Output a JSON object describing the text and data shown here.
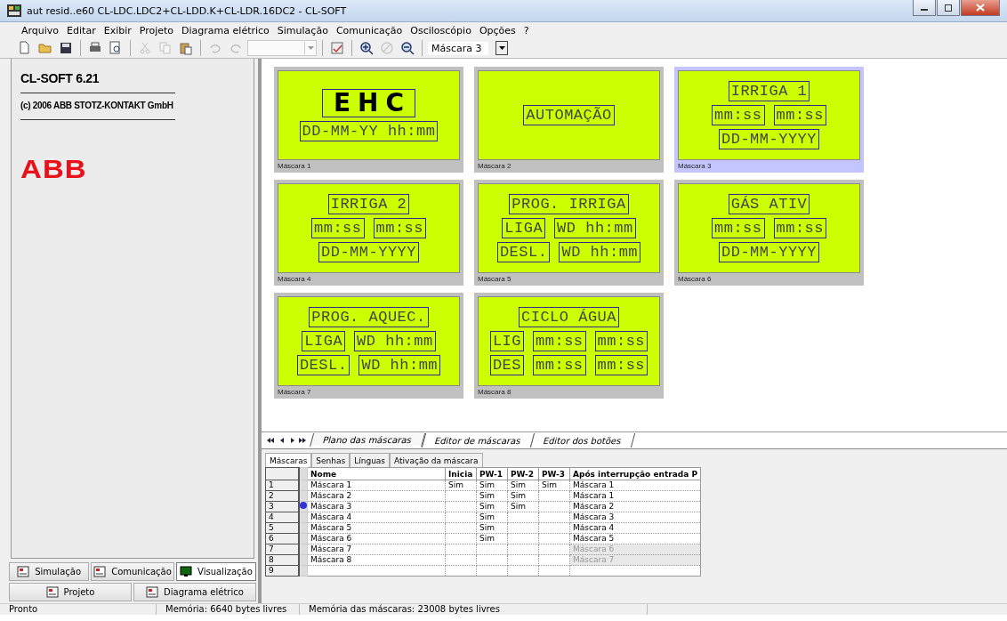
{
  "window": {
    "title": "aut resid..e60 CL-LDC.LDC2+CL-LDD.K+CL-LDR.16DC2 - CL-SOFT"
  },
  "menu": [
    "Arquivo",
    "Editar",
    "Exibir",
    "Projeto",
    "Diagrama elétrico",
    "Simulação",
    "Comunicação",
    "Osciloscópio",
    "Opções",
    "?"
  ],
  "toolbar": {
    "buttons": [
      {
        "disabled": false
      },
      {
        "disabled": false
      },
      {
        "disabled": false
      },
      {
        "disabled": false
      },
      {
        "disabled": false
      },
      {
        "disabled": true
      },
      {
        "disabled": true
      },
      {
        "disabled": false
      },
      {
        "disabled": true
      },
      {
        "disabled": true
      },
      {
        "disabled": false
      },
      {
        "disabled": false
      },
      {
        "disabled": true
      },
      {
        "disabled": false
      }
    ],
    "mask_select": {
      "value": "Máscara 3"
    }
  },
  "sidebar": {
    "title": "CL-SOFT 6.21",
    "copyright": "(c) 2006 ABB STOTZ-KONTAKT GmbH",
    "logo": "ABB",
    "nav": [
      {
        "label": "Simulação",
        "selected": false
      },
      {
        "label": "Comunicação",
        "selected": false
      },
      {
        "label": "Visualização",
        "selected": true
      },
      {
        "label": "Projeto",
        "selected": false
      },
      {
        "label": "Diagrama elétrico",
        "selected": false
      }
    ]
  },
  "masks": [
    {
      "label": "Máscara 1",
      "selected": false,
      "lines": [
        [
          {
            "text": "EHC",
            "kind": "bitmap"
          }
        ],
        [
          {
            "text": "DD-MM-YY hh:mm",
            "kind": "text"
          }
        ]
      ]
    },
    {
      "label": "Máscara 2",
      "selected": false,
      "lines": [
        [
          {
            "text": "AUTOMAÇÃO",
            "kind": "text"
          }
        ]
      ]
    },
    {
      "label": "Máscara 3",
      "selected": true,
      "lines": [
        [
          {
            "text": "IRRIGA 1",
            "kind": "text"
          }
        ],
        [
          {
            "text": "mm:ss",
            "kind": "text"
          },
          {
            "text": "mm:ss",
            "kind": "text"
          }
        ],
        [
          {
            "text": "DD-MM-YYYY",
            "kind": "text"
          }
        ]
      ]
    },
    {
      "label": "Máscara 4",
      "selected": false,
      "lines": [
        [
          {
            "text": "IRRIGA 2",
            "kind": "text"
          }
        ],
        [
          {
            "text": "mm:ss",
            "kind": "text"
          },
          {
            "text": "mm:ss",
            "kind": "text"
          }
        ],
        [
          {
            "text": "DD-MM-YYYY",
            "kind": "text"
          }
        ]
      ]
    },
    {
      "label": "Máscara 5",
      "selected": false,
      "lines": [
        [
          {
            "text": "PROG. IRRIGA",
            "kind": "text"
          }
        ],
        [
          {
            "text": "LIGA",
            "kind": "text"
          },
          {
            "text": "WD hh:mm",
            "kind": "text"
          }
        ],
        [
          {
            "text": "DESL.",
            "kind": "text"
          },
          {
            "text": "WD hh:mm",
            "kind": "text"
          }
        ]
      ]
    },
    {
      "label": "Máscara 6",
      "selected": false,
      "lines": [
        [
          {
            "text": "GÁS ATIV",
            "kind": "text"
          }
        ],
        [
          {
            "text": "mm:ss",
            "kind": "text"
          },
          {
            "text": "mm:ss",
            "kind": "text"
          }
        ],
        [
          {
            "text": "DD-MM-YYYY",
            "kind": "text"
          }
        ]
      ]
    },
    {
      "label": "Máscara 7",
      "selected": false,
      "lines": [
        [
          {
            "text": "PROG. AQUEC.",
            "kind": "text"
          }
        ],
        [
          {
            "text": "LIGA",
            "kind": "text"
          },
          {
            "text": "WD hh:mm",
            "kind": "text"
          }
        ],
        [
          {
            "text": "DESL.",
            "kind": "text"
          },
          {
            "text": "WD hh:mm",
            "kind": "text"
          }
        ]
      ]
    },
    {
      "label": "Máscara 8",
      "selected": false,
      "lines": [
        [
          {
            "text": "CICLO ÁGUA",
            "kind": "text"
          }
        ],
        [
          {
            "text": "LIG",
            "kind": "text"
          },
          {
            "text": "mm:ss",
            "kind": "text"
          },
          {
            "text": "mm:ss",
            "kind": "text"
          }
        ],
        [
          {
            "text": "DES",
            "kind": "text"
          },
          {
            "text": "mm:ss",
            "kind": "text"
          },
          {
            "text": "mm:ss",
            "kind": "text"
          }
        ]
      ]
    }
  ],
  "sheet_tabs": [
    {
      "label": "Plano das máscaras",
      "selected": true
    },
    {
      "label": "Editor de máscaras",
      "selected": false
    },
    {
      "label": "Editor dos botões",
      "selected": false
    }
  ],
  "table_tabs": [
    {
      "label": "Máscaras",
      "selected": true
    },
    {
      "label": "Senhas",
      "selected": false
    },
    {
      "label": "Línguas",
      "selected": false
    },
    {
      "label": "Ativação da máscara",
      "selected": false
    }
  ],
  "table": {
    "columns": [
      "Nome",
      "Inicia",
      "PW-1",
      "PW-2",
      "PW-3",
      "Após interrupção entrada P"
    ],
    "rows": [
      {
        "number": "1",
        "selected": false,
        "disabled": false,
        "cells": [
          "Máscara 1",
          "Sim",
          "Sim",
          "Sim",
          "Sim",
          "Máscara 1"
        ]
      },
      {
        "number": "2",
        "selected": false,
        "disabled": false,
        "cells": [
          "Máscara 2",
          "",
          "Sim",
          "Sim",
          "",
          "Máscara 1"
        ]
      },
      {
        "number": "3",
        "selected": true,
        "disabled": false,
        "cells": [
          "Máscara 3",
          "",
          "Sim",
          "Sim",
          "",
          "Máscara 2"
        ]
      },
      {
        "number": "4",
        "selected": false,
        "disabled": false,
        "cells": [
          "Máscara 4",
          "",
          "Sim",
          "",
          "",
          "Máscara 3"
        ]
      },
      {
        "number": "5",
        "selected": false,
        "disabled": false,
        "cells": [
          "Máscara 5",
          "",
          "Sim",
          "",
          "",
          "Máscara 4"
        ]
      },
      {
        "number": "6",
        "selected": false,
        "disabled": false,
        "cells": [
          "Máscara 6",
          "",
          "Sim",
          "",
          "",
          "Máscara 5"
        ]
      },
      {
        "number": "7",
        "selected": false,
        "disabled": true,
        "cells": [
          "Máscara 7",
          "",
          "",
          "",
          "",
          "Máscara 6"
        ]
      },
      {
        "number": "8",
        "selected": false,
        "disabled": true,
        "cells": [
          "Máscara 8",
          "",
          "",
          "",
          "",
          "Máscara 7"
        ]
      },
      {
        "number": "9",
        "selected": false,
        "disabled": false,
        "cells": [
          "",
          "",
          "",
          "",
          "",
          ""
        ]
      }
    ]
  },
  "status_bar": [
    "Pronto",
    "Memória: 6640 bytes livres",
    "Memória das máscaras: 23008 bytes livres"
  ]
}
